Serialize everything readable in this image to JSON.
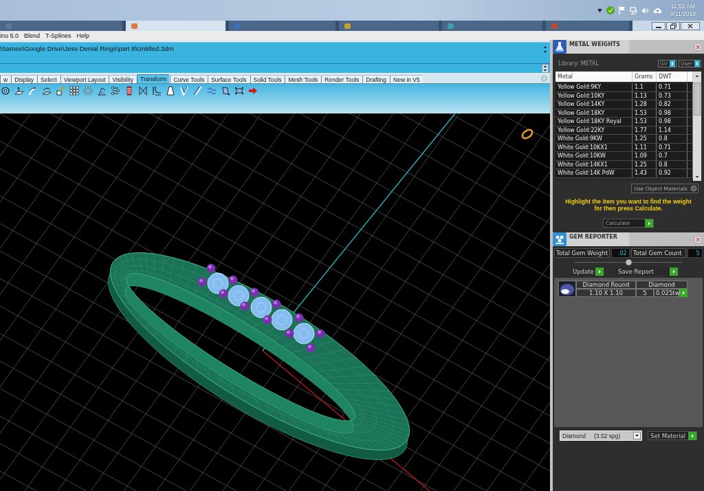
{
  "taskbar": {
    "time": "11:51 AM",
    "date": "9/11/2018"
  },
  "window_tabs": [
    {
      "selected": false
    },
    {
      "selected": true
    },
    {
      "selected": false
    },
    {
      "selected": false
    },
    {
      "selected": false
    },
    {
      "selected": false
    }
  ],
  "menu_bar": {
    "items": [
      "ino 5.0",
      "Blend",
      "T-Splines",
      "Help"
    ]
  },
  "command_area": {
    "history": "\\Samee\\Google Drive\\Jess Denial Rings\\part 8\\Untitled.3dm"
  },
  "toolbar_tabs": [
    {
      "label": "w",
      "selected": false
    },
    {
      "label": "Display",
      "selected": false
    },
    {
      "label": "Select",
      "selected": false
    },
    {
      "label": "Viewport Layout",
      "selected": false
    },
    {
      "label": "Visibility",
      "selected": false
    },
    {
      "label": "Transform",
      "selected": true
    },
    {
      "label": "Curve Tools",
      "selected": false
    },
    {
      "label": "Surface Tools",
      "selected": false
    },
    {
      "label": "Solid Tools",
      "selected": false
    },
    {
      "label": "Mesh Tools",
      "selected": false
    },
    {
      "label": "Render Tools",
      "selected": false
    },
    {
      "label": "Drafting",
      "selected": false
    },
    {
      "label": "New in V5",
      "selected": false
    }
  ],
  "metal_weights": {
    "title": "METAL WEIGHTS",
    "library": "Library: METAL",
    "toggles": [
      {
        "label": "GV",
        "on": true
      },
      {
        "label": "User",
        "on": true
      }
    ],
    "table": {
      "columns": [
        "Metal",
        "Grams",
        "DWT"
      ],
      "rows": [
        {
          "cells": [
            "Yellow Gold:9KY",
            "1.1",
            "0.71"
          ],
          "selected": false
        },
        {
          "cells": [
            "Yellow Gold:10KY",
            "1.13",
            "0.73"
          ],
          "selected": false
        },
        {
          "cells": [
            "Yellow Gold:14KY",
            "1.28",
            "0.82"
          ],
          "selected": false
        },
        {
          "cells": [
            "Yellow Gold:18KY",
            "1.53",
            "0.98"
          ],
          "selected": false
        },
        {
          "cells": [
            "Yellow Gold:18KY Royal",
            "1.53",
            "0.98"
          ],
          "selected": false
        },
        {
          "cells": [
            "Yellow Gold:22KY",
            "1.77",
            "1.14"
          ],
          "selected": false
        },
        {
          "cells": [
            "White Gold:9KW",
            "1.25",
            "0.8"
          ],
          "selected": false
        },
        {
          "cells": [
            "White Gold:10KX1",
            "1.11",
            "0.71"
          ],
          "selected": false
        },
        {
          "cells": [
            "White Gold:10KW",
            "1.09",
            "0.7"
          ],
          "selected": false
        },
        {
          "cells": [
            "White Gold:14KX1",
            "1.25",
            "0.8"
          ],
          "selected": false
        },
        {
          "cells": [
            "White Gold:14K PdW",
            "1.43",
            "0.92"
          ],
          "selected": false
        }
      ]
    },
    "use_object_materials": "Use Object Materials",
    "instruction": "Highlight the item you want to find the weight for then press Calculate.",
    "calculate": "Calculate"
  },
  "gem_reporter": {
    "title": "GEM REPORTER",
    "total_weight": {
      "label": "Total Gem Weight",
      "value": ".02"
    },
    "total_count": {
      "label": "Total Gem Count",
      "value": "5"
    },
    "buttons": [
      "Update",
      "Save Report"
    ],
    "gems": [
      {
        "shape": "Diamond Round",
        "material": "Diamond",
        "size": "1.10 X 1.10",
        "count": "5",
        "weight": "0.025tw"
      }
    ],
    "material_select": {
      "value": "Diamond",
      "density": "(3.52 spg)"
    },
    "set_material": "Set Material"
  }
}
